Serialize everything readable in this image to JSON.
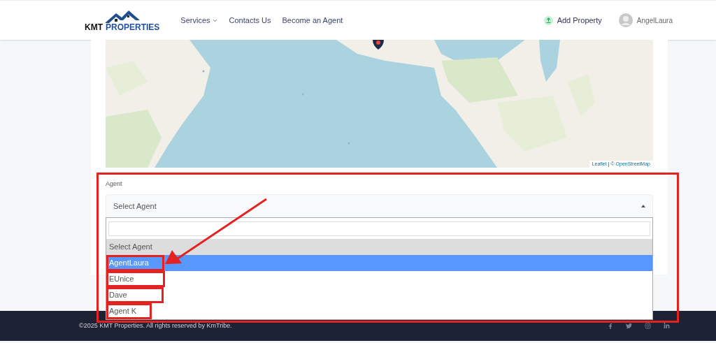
{
  "header": {
    "logo": {
      "first": "KMT",
      "second": "PROPERTIES"
    },
    "nav": [
      {
        "label": "Services",
        "kind": "dropdown"
      },
      {
        "label": "Contacts Us",
        "kind": "link"
      },
      {
        "label": "Become an Agent",
        "kind": "link"
      }
    ],
    "add_property": "Add Property",
    "user": "AngelLaura"
  },
  "map": {
    "kind": "picture",
    "attribution_link": "Leaflet",
    "attribution_separator": "|",
    "attribution_text": "© OpenStreetMap"
  },
  "agent_field": {
    "label": "Agent",
    "value": "Select Agent",
    "expanded": true,
    "options": [
      {
        "label": "Select Agent",
        "selected": true,
        "highlighted": false
      },
      {
        "label": "AgentLaura",
        "selected": false,
        "highlighted": true
      },
      {
        "label": "EUnice",
        "selected": false,
        "highlighted": false
      },
      {
        "label": "Dave",
        "selected": false,
        "highlighted": false
      },
      {
        "label": "Agent K",
        "selected": false,
        "highlighted": false
      }
    ]
  },
  "footer": {
    "copyright": "©2025 KMT Properties. All rights reserved by KmTribe."
  }
}
